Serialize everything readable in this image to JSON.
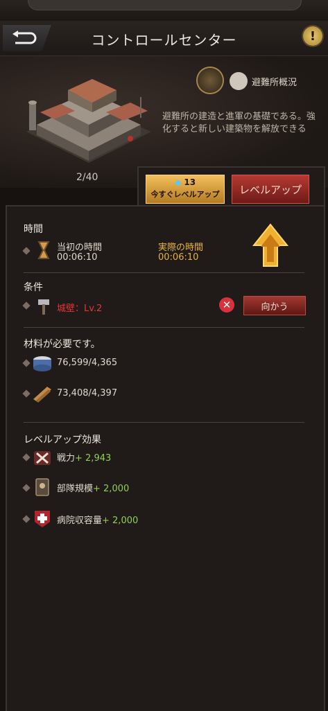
{
  "header": {
    "title": "コントロールセンター"
  },
  "building": {
    "level_count": "2/40",
    "overview_label": "避難所概況",
    "description": "避難所の建造と進軍の基礎である。強化すると新しい建築物を解放できる"
  },
  "actions": {
    "instant_gems": "13",
    "instant_label": "今すぐレベルアップ",
    "levelup_label": "レベルアップ"
  },
  "time": {
    "section_title": "時間",
    "initial_label": "当初の時間",
    "initial_value": "00:06:10",
    "actual_label": "実際の時間",
    "actual_value": "00:06:10"
  },
  "conditions": {
    "section_title": "条件",
    "requirement": "城壁：Lv.2",
    "go_button": "向かう"
  },
  "materials": {
    "section_title": "材料が必要です。",
    "items": [
      {
        "value": "76,599/4,365",
        "icon": "canned-food-icon"
      },
      {
        "value": "73,408/4,397",
        "icon": "wood-icon"
      }
    ]
  },
  "effects": {
    "section_title": "レベルアップ効果",
    "items": [
      {
        "label": "戦力",
        "value": "+ 2,943",
        "icon": "power-icon"
      },
      {
        "label": "部隊規模",
        "value": "+ 2,000",
        "icon": "troop-icon"
      },
      {
        "label": "病院収容量",
        "value": "+ 2,000",
        "icon": "hospital-icon"
      }
    ]
  },
  "colors": {
    "gold": "#e8b33a",
    "green": "#8ed156",
    "red_text": "#e5363b"
  }
}
